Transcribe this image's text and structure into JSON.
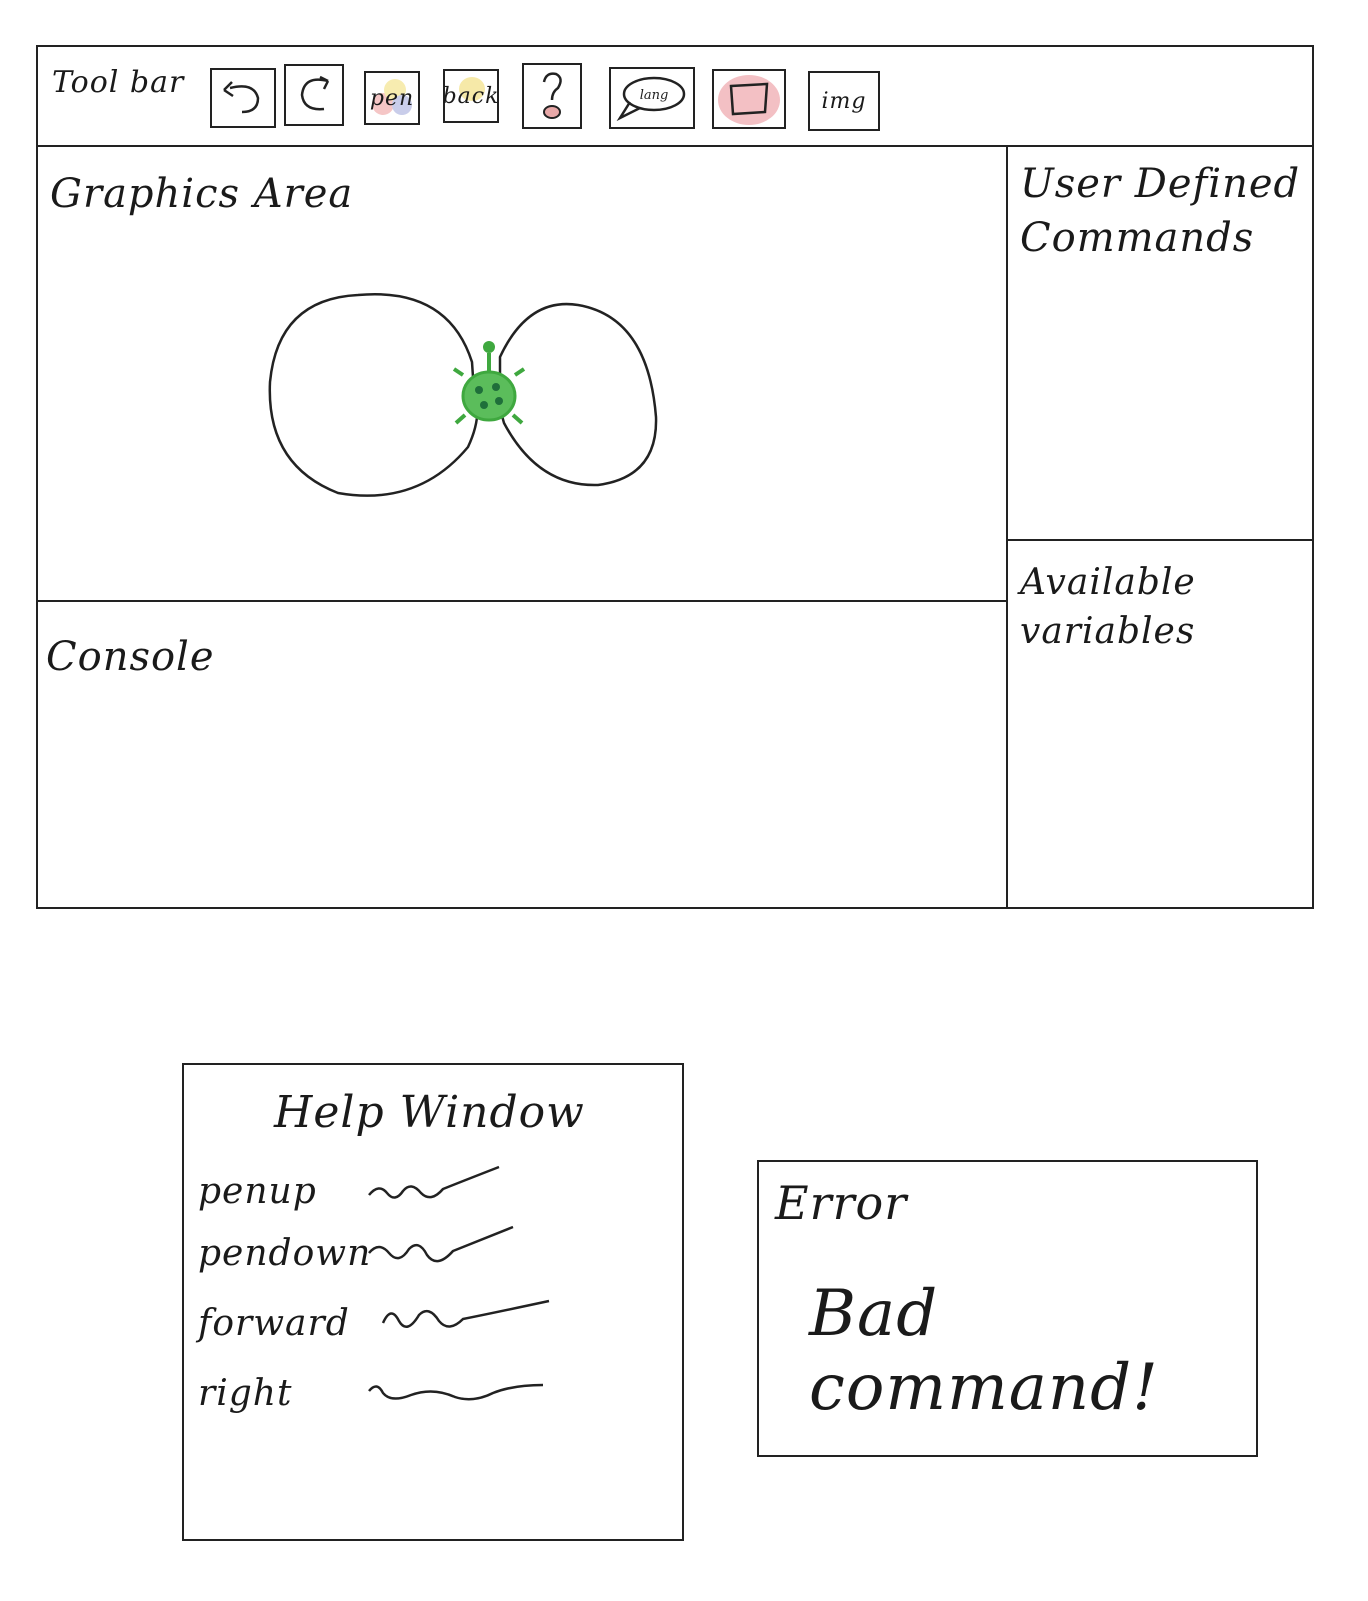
{
  "toolbar": {
    "label": "Tool bar",
    "buttons": {
      "undo": "",
      "redo": "",
      "pen": "pen",
      "back": "back",
      "help": "?",
      "lang": "lang",
      "shape": "",
      "img": "img"
    }
  },
  "graphics_area": {
    "title": "Graphics Area",
    "turtle_color": "#3fa83f",
    "turtle_spot_color": "#1f6f3a"
  },
  "console": {
    "title": "Console"
  },
  "user_commands": {
    "title_line1": "User Defined",
    "title_line2": "Commands"
  },
  "variables": {
    "title": "Available variables"
  },
  "help_window": {
    "title": "Help Window",
    "commands": [
      "penup",
      "pendown",
      "forward",
      "right"
    ]
  },
  "error_window": {
    "title": "Error",
    "message": "Bad command!"
  },
  "colors": {
    "pen_swatch_1": "#f5c6c6",
    "pen_swatch_2": "#f7ecb0",
    "pen_swatch_3": "#c9cdea",
    "back_swatch": "#f6e9a8",
    "help_accent": "#e8a8a8",
    "shape_fill": "#f3c0c4"
  }
}
